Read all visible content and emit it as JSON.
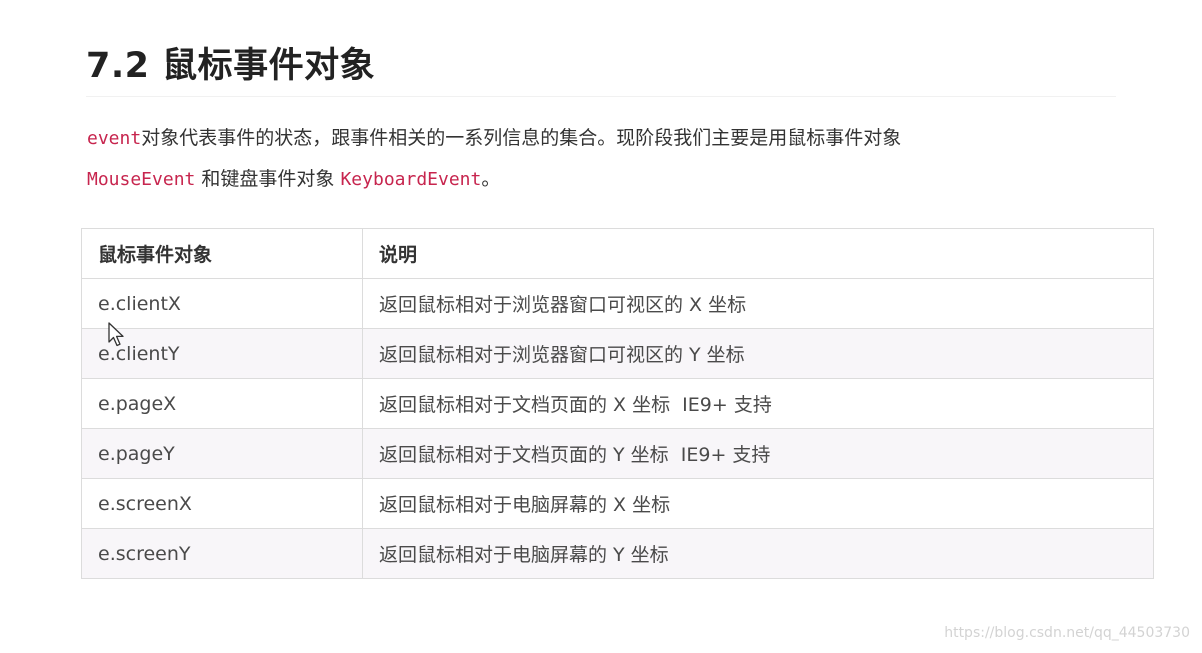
{
  "section": {
    "title": "7.2 鼠标事件对象"
  },
  "intro": {
    "code_event": "event",
    "text_1": "对象代表事件的状态，跟事件相关的一系列信息的集合。现阶段我们主要是用鼠标事件对象",
    "code_mouse_event": "MouseEvent",
    "text_2": " 和键盘事件对象 ",
    "code_keyboard_event": "KeyboardEvent",
    "text_3": "。"
  },
  "table": {
    "headers": [
      "鼠标事件对象",
      "说明"
    ],
    "rows": [
      {
        "property": "e.clientX",
        "description": "返回鼠标相对于浏览器窗口可视区的 X 坐标"
      },
      {
        "property": "e.clientY",
        "description": "返回鼠标相对于浏览器窗口可视区的 Y 坐标"
      },
      {
        "property": "e.pageX",
        "description": "返回鼠标相对于文档页面的 X 坐标  IE9+ 支持"
      },
      {
        "property": "e.pageY",
        "description": "返回鼠标相对于文档页面的 Y 坐标  IE9+ 支持"
      },
      {
        "property": "e.screenX",
        "description": "返回鼠标相对于电脑屏幕的 X 坐标"
      },
      {
        "property": "e.screenY",
        "description": "返回鼠标相对于电脑屏幕的 Y 坐标"
      }
    ]
  },
  "watermark": {
    "text": "https://blog.csdn.net/qq_44503730"
  },
  "icons": {
    "cursor": "mouse-pointer-icon"
  },
  "colors": {
    "code_text": "#c7254e",
    "table_border": "#dcdcdc",
    "alt_row_bg": "#f8f6f9"
  }
}
